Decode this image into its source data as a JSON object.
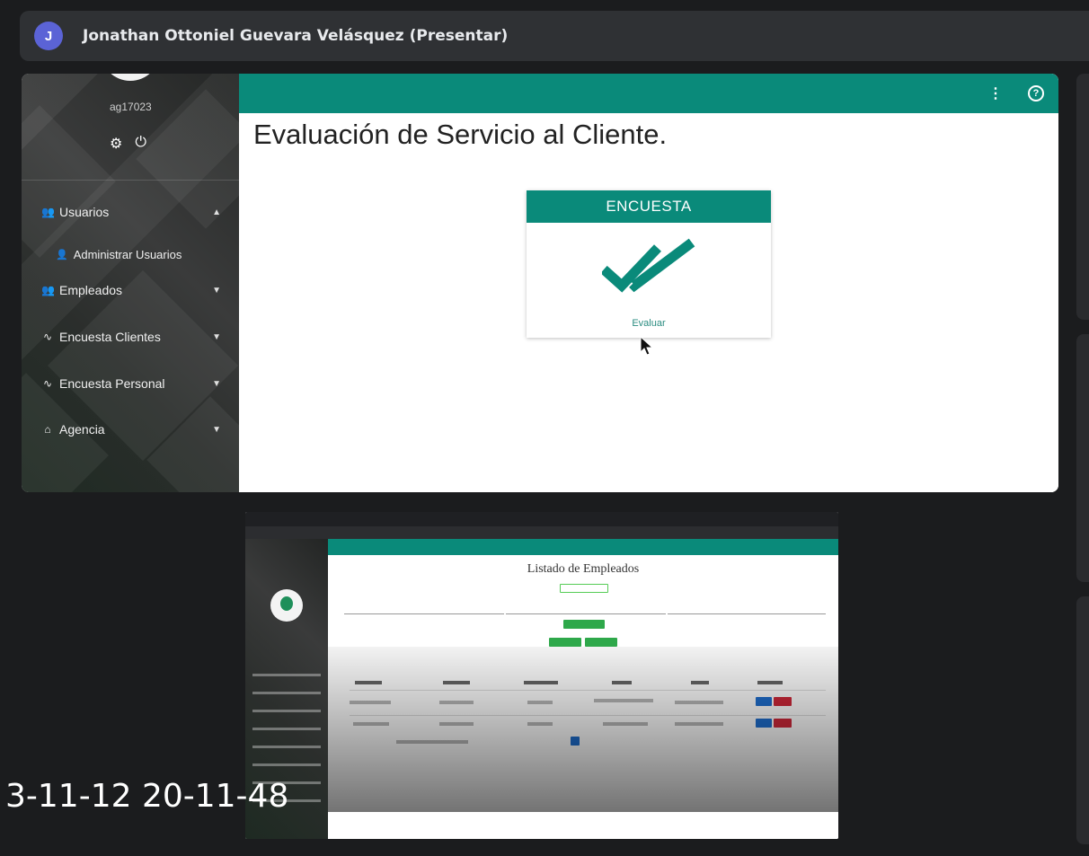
{
  "meeting": {
    "avatar_initial": "J",
    "presenter_name": "Jonathan Ottoniel Guevara Velásquez (Presentar)"
  },
  "app": {
    "colors": {
      "primary": "#0a8a7a",
      "sidebar": "#2b2e2c"
    },
    "sidebar": {
      "username": "ag17023",
      "items": [
        {
          "label": "Usuarios",
          "icon": "users-icon",
          "expanded": true
        },
        {
          "label": "Empleados",
          "icon": "users-icon",
          "expanded": false
        },
        {
          "label": "Encuesta Clientes",
          "icon": "pulse-icon",
          "expanded": false
        },
        {
          "label": "Encuesta Personal",
          "icon": "pulse-icon",
          "expanded": false
        },
        {
          "label": "Agencia",
          "icon": "home-icon",
          "expanded": false
        }
      ],
      "subitem": {
        "label": "Administrar Usuarios",
        "icon": "person-icon"
      }
    },
    "page_title": "Evaluación de Servicio al Cliente.",
    "card": {
      "header": "ENCUESTA",
      "icon": "double-check-icon",
      "link_label": "Evaluar"
    }
  },
  "thumbnail": {
    "title": "Listado de Empleados"
  },
  "timestamp": "3-11-12 20-11-48"
}
